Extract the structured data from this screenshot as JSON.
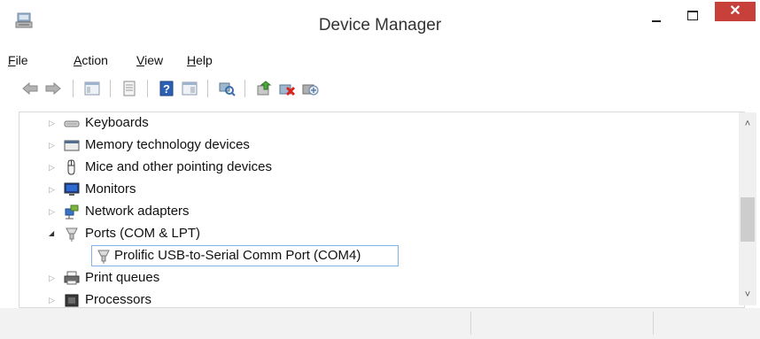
{
  "window": {
    "title": "Device Manager"
  },
  "title_buttons": {
    "minimize": "–",
    "maximize": "□",
    "close": "✕"
  },
  "menu": [
    {
      "first": "F",
      "rest": "ile"
    },
    {
      "first": "A",
      "rest": "ction"
    },
    {
      "first": "V",
      "rest": "iew"
    },
    {
      "first": "H",
      "rest": "elp"
    }
  ],
  "tree": [
    {
      "label": "Keyboards",
      "icon": "keyboard-icon",
      "expander": "▷"
    },
    {
      "label": "Memory technology devices",
      "icon": "memory-device-icon",
      "expander": "▷"
    },
    {
      "label": "Mice and other pointing devices",
      "icon": "mouse-icon",
      "expander": "▷"
    },
    {
      "label": "Monitors",
      "icon": "monitor-icon",
      "expander": "▷"
    },
    {
      "label": "Network adapters",
      "icon": "network-adapter-icon",
      "expander": "▷"
    },
    {
      "label": "Ports (COM & LPT)",
      "icon": "port-icon",
      "expander": "◢"
    },
    {
      "label": "Prolific USB-to-Serial Comm Port (COM4)",
      "icon": "port-icon"
    },
    {
      "label": "Print queues",
      "icon": "printer-icon",
      "expander": "▷"
    },
    {
      "label": "Processors",
      "icon": "processor-icon",
      "expander": "▷"
    }
  ],
  "scrollbar": {
    "up": "˄",
    "down": "˅"
  },
  "colors": {
    "close_button": "#c7413a",
    "selection_border": "#7eb4ea"
  }
}
